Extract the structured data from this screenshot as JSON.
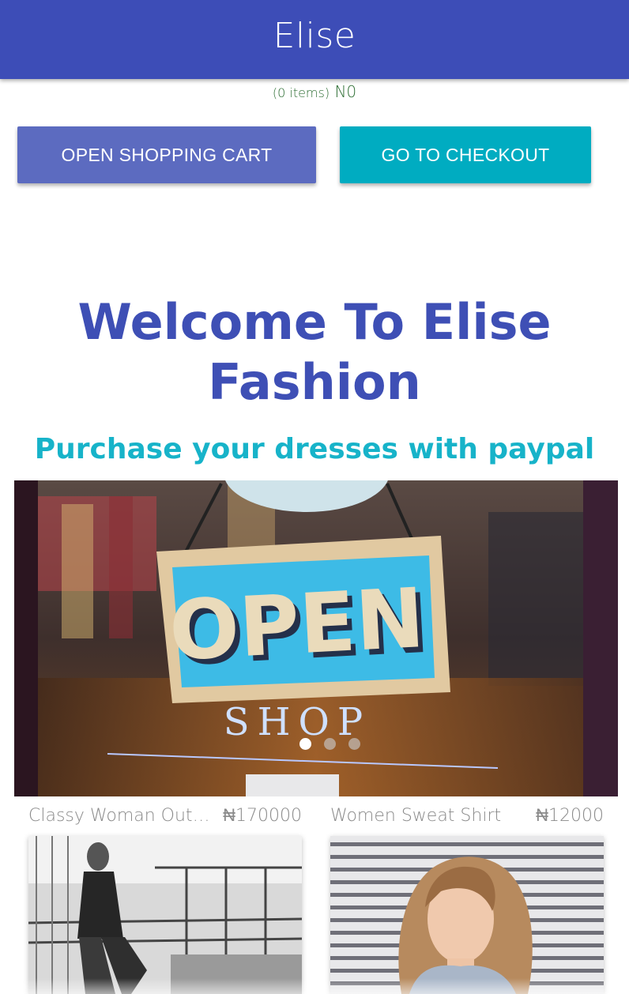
{
  "app": {
    "title": "Elise"
  },
  "cart": {
    "items_label": "(0 items)",
    "total": "N0"
  },
  "buttons": {
    "open_cart": "OPEN SHOPPING CART",
    "checkout": "GO TO CHECKOUT"
  },
  "hero": {
    "welcome_line1": "Welcome To Elise",
    "welcome_line2": "Fashion",
    "subtitle": "Purchase your dresses with paypal"
  },
  "carousel": {
    "sign_text": "OPEN",
    "shop_text": "SHOP",
    "active_index": 0,
    "slide_count": 3
  },
  "products": [
    {
      "name": "Classy Woman Outfit...",
      "price": "₦170000"
    },
    {
      "name": "Women Sweat Shirt",
      "price": "₦12000"
    }
  ],
  "colors": {
    "primary": "#3d4db7",
    "button_cart": "#5c6bc0",
    "button_checkout": "#00acc1",
    "subtitle": "#17b3c9"
  }
}
